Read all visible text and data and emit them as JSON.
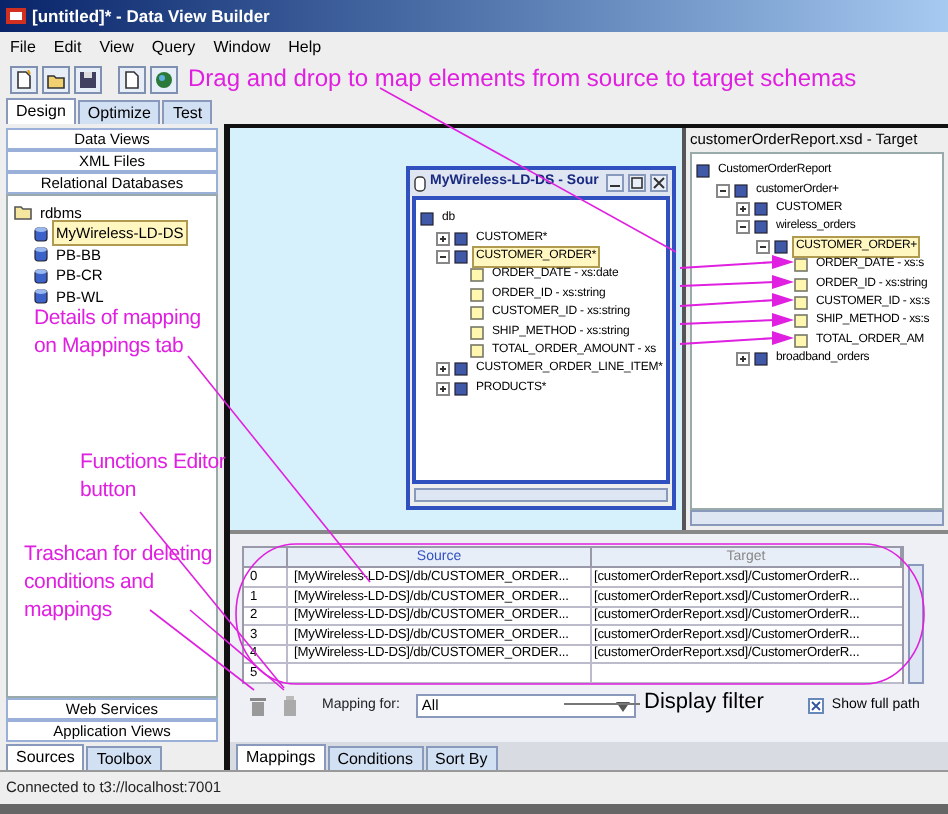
{
  "window": {
    "title": "[untitled]* - Data View Builder"
  },
  "menu": [
    "File",
    "Edit",
    "View",
    "Query",
    "Window",
    "Help"
  ],
  "main_tabs": [
    {
      "label": "Design",
      "selected": true
    },
    {
      "label": "Optimize",
      "selected": false
    },
    {
      "label": "Test",
      "selected": false
    }
  ],
  "sidebar": {
    "top_sections": [
      "Data Views",
      "XML Files",
      "Relational Databases"
    ],
    "tree": {
      "label": "rdbms",
      "selected": false,
      "children": [
        {
          "label": "MyWireless-LD-DS",
          "selected": true
        },
        {
          "label": "PB-BB",
          "selected": false
        },
        {
          "label": "PB-CR",
          "selected": false
        },
        {
          "label": "PB-WL",
          "selected": false
        }
      ]
    },
    "bottom_sections": [
      "Web Services",
      "Application Views"
    ],
    "tabs": [
      {
        "label": "Sources",
        "selected": true
      },
      {
        "label": "Toolbox",
        "selected": false
      }
    ]
  },
  "source_window": {
    "title": "MyWireless-LD-DS - Sour",
    "tree": {
      "label": "db",
      "selected": false,
      "children": [
        {
          "label": "CUSTOMER*",
          "expanded": false,
          "selected": false
        },
        {
          "label": "CUSTOMER_ORDER*",
          "expanded": true,
          "selected": true,
          "children": [
            {
              "label": "ORDER_DATE - xs:date",
              "selected": false
            },
            {
              "label": "ORDER_ID - xs:string",
              "selected": false
            },
            {
              "label": "CUSTOMER_ID - xs:string",
              "selected": false
            },
            {
              "label": "SHIP_METHOD - xs:string",
              "selected": false
            },
            {
              "label": "TOTAL_ORDER_AMOUNT - xs",
              "selected": false
            }
          ]
        },
        {
          "label": "CUSTOMER_ORDER_LINE_ITEM*",
          "expanded": false,
          "selected": false
        },
        {
          "label": "PRODUCTS*",
          "expanded": false,
          "selected": false
        }
      ]
    }
  },
  "target_panel": {
    "title": "customerOrderReport.xsd - Target",
    "tree": {
      "label": "CustomerOrderReport",
      "selected": false,
      "children": [
        {
          "label": "customerOrder+",
          "expanded": true,
          "selected": false,
          "children": [
            {
              "label": "CUSTOMER",
              "expanded": false,
              "selected": false
            },
            {
              "label": "wireless_orders",
              "expanded": true,
              "selected": false,
              "children": [
                {
                  "label": "CUSTOMER_ORDER+",
                  "expanded": true,
                  "selected": true,
                  "children": [
                    {
                      "label": "ORDER_DATE - xs:s",
                      "selected": false
                    },
                    {
                      "label": "ORDER_ID - xs:string",
                      "selected": false
                    },
                    {
                      "label": "CUSTOMER_ID - xs:s",
                      "selected": false
                    },
                    {
                      "label": "SHIP_METHOD - xs:s",
                      "selected": false
                    },
                    {
                      "label": "TOTAL_ORDER_AM",
                      "selected": false
                    }
                  ]
                }
              ]
            },
            {
              "label": "broadband_orders",
              "expanded": false,
              "selected": false
            }
          ]
        }
      ]
    }
  },
  "mappings": {
    "columns": [
      "Source",
      "Target"
    ],
    "rows": [
      {
        "index": "0",
        "source": "[MyWireless-LD-DS]/db/CUSTOMER_ORDER...",
        "target": "[customerOrderReport.xsd]/CustomerOrderR..."
      },
      {
        "index": "1",
        "source": "[MyWireless-LD-DS]/db/CUSTOMER_ORDER...",
        "target": "[customerOrderReport.xsd]/CustomerOrderR..."
      },
      {
        "index": "2",
        "source": "[MyWireless-LD-DS]/db/CUSTOMER_ORDER...",
        "target": "[customerOrderReport.xsd]/CustomerOrderR..."
      },
      {
        "index": "3",
        "source": "[MyWireless-LD-DS]/db/CUSTOMER_ORDER...",
        "target": "[customerOrderReport.xsd]/CustomerOrderR..."
      },
      {
        "index": "4",
        "source": "[MyWireless-LD-DS]/db/CUSTOMER_ORDER...",
        "target": "[customerOrderReport.xsd]/CustomerOrderR..."
      },
      {
        "index": "5"
      }
    ],
    "mapping_for": {
      "label": "Mapping for:",
      "value": "All"
    },
    "show_full_path": {
      "label": "Show full path",
      "checked": true
    },
    "tabs": [
      {
        "label": "Mappings",
        "selected": true
      },
      {
        "label": "Conditions",
        "selected": false
      },
      {
        "label": "Sort By",
        "selected": false
      }
    ]
  },
  "annotations": [
    {
      "kind": "callout",
      "text": "Drag and drop to map elements from source to target schemas"
    },
    {
      "kind": "callout",
      "text": "Details of mapping on Mappings tab"
    },
    {
      "kind": "callout",
      "text": "Functions Editor button"
    },
    {
      "kind": "callout",
      "text": "Trashcan for deleting conditions and mappings"
    },
    {
      "kind": "label",
      "text": "Display filter"
    }
  ],
  "status_bar": "Connected to t3://localhost:7001"
}
